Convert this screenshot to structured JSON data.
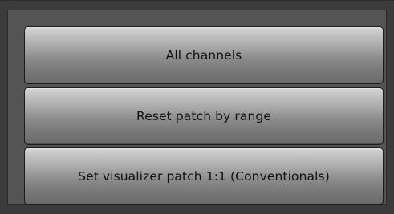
{
  "menu": {
    "items": [
      {
        "label": "All channels"
      },
      {
        "label": "Reset patch by range"
      },
      {
        "label": "Set visualizer patch 1:1 (Conventionals)"
      }
    ]
  },
  "colors": {
    "background": "#3b3b3b",
    "panel": "#545454",
    "button_top": "#d7d7d7",
    "button_bottom": "#6a6a6a",
    "button_text": "#111111"
  }
}
